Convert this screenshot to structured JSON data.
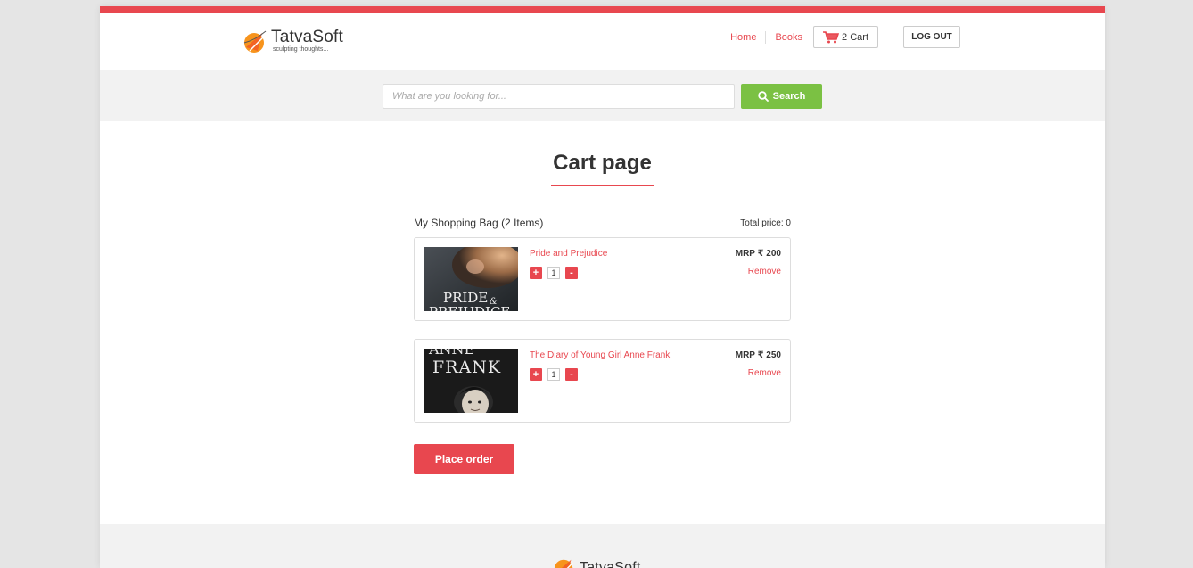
{
  "brand": {
    "name": "TatvaSoft",
    "tagline": "sculpting thoughts...",
    "accent_color": "#e8474f",
    "search_color": "#7bc143"
  },
  "nav": {
    "home": "Home",
    "books": "Books",
    "cart_count": "2",
    "cart_label": "Cart",
    "logout": "LOG OUT"
  },
  "search": {
    "placeholder": "What are you looking for...",
    "button_label": "Search"
  },
  "page": {
    "title": "Cart page"
  },
  "cart": {
    "bag_title": "My Shopping Bag (2 Items)",
    "total_price": "Total price: 0",
    "items": [
      {
        "name": "Pride and Prejudice",
        "cover_line1": "PRIDE",
        "cover_amp": "&",
        "cover_line2": "PREJUDICE",
        "quantity": "1",
        "price": "MRP ₹ 200",
        "remove": "Remove"
      },
      {
        "name": "The Diary of Young Girl Anne Frank",
        "cover_line1": "ANNE",
        "cover_line2": "FRANK",
        "quantity": "1",
        "price": "MRP ₹ 250",
        "remove": "Remove"
      }
    ],
    "plus_symbol": "+",
    "minus_symbol": "-",
    "place_order": "Place order"
  },
  "icons": {
    "logo": "tatvasoft-logo-icon",
    "cart": "shopping-cart-icon",
    "search": "search-icon"
  }
}
